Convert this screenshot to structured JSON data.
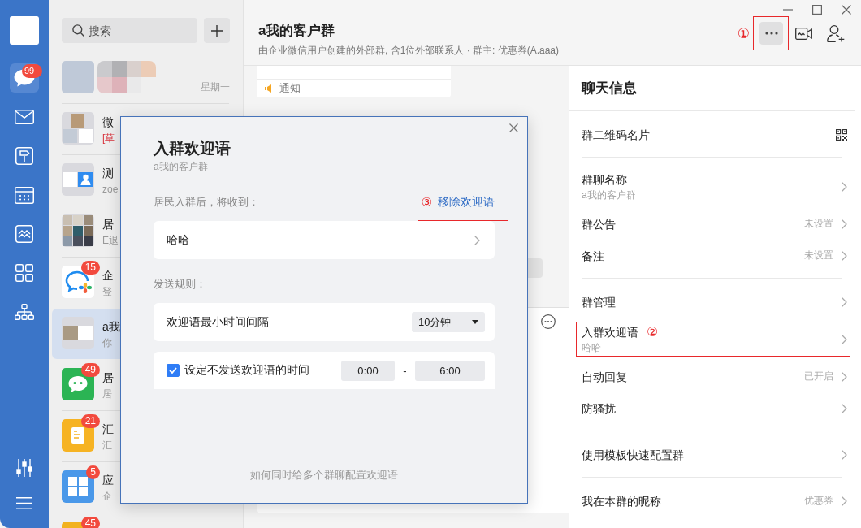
{
  "nav_rail": {
    "items": [
      {
        "kind": "chat",
        "selected": true,
        "badge": "99+"
      },
      {
        "kind": "mail",
        "selected": false
      },
      {
        "kind": "workbench",
        "selected": false
      },
      {
        "kind": "calendar",
        "selected": false
      },
      {
        "kind": "drive",
        "selected": false
      },
      {
        "kind": "apps",
        "selected": false
      },
      {
        "kind": "contacts",
        "selected": false
      }
    ]
  },
  "chat_list": {
    "search": {
      "placeholder": "搜索"
    },
    "items": [
      {
        "kind": "photo",
        "name_blurred": true,
        "time": "星期一",
        "selected": false
      },
      {
        "kind": "collage",
        "name": "微",
        "draft_tag": "[草",
        "name_blurred": false,
        "selected": false
      },
      {
        "kind": "screenshot-contact",
        "name": "测",
        "preview": "zoe",
        "name_blurred": false,
        "selected": false
      },
      {
        "kind": "photo-grid",
        "name": "居",
        "preview": "E退",
        "name_blurred": false,
        "selected": false
      },
      {
        "kind": "wecom",
        "name": "企",
        "preview": "登",
        "badge": "15",
        "name_blurred": false,
        "selected": false
      },
      {
        "kind": "screenshot-photo",
        "name": "a我",
        "preview": "你",
        "name_blurred": false,
        "selected": true
      },
      {
        "kind": "wechat",
        "name": "居",
        "preview": "居",
        "badge": "49",
        "name_blurred": false,
        "selected": false
      },
      {
        "kind": "report",
        "name": "汇",
        "preview": "汇",
        "badge": "21",
        "name_blurred": false,
        "selected": false
      },
      {
        "kind": "apps",
        "name": "应",
        "preview": "企",
        "badge": "5",
        "name_blurred": false,
        "selected": false
      },
      {
        "kind": "health",
        "badge": "45",
        "name_blurred": false,
        "selected": false
      }
    ]
  },
  "chat_header": {
    "title": "a我的客户群",
    "subtitle": "由企业微信用户创建的外部群, 含1位外部联系人 · 群主: 优惠券(A.aaa)",
    "actions": [
      {
        "kind": "more",
        "annotation": "①"
      },
      {
        "kind": "video"
      },
      {
        "kind": "add-member"
      }
    ]
  },
  "chat_area": {
    "notice": "通知"
  },
  "chat_info": {
    "title": "聊天信息",
    "groups": [
      {
        "items": [
          {
            "kind": "qr",
            "label": "群二维码名片"
          }
        ]
      },
      {
        "items": [
          {
            "kind": "link",
            "label": "群聊名称",
            "sub": "a我的客户群"
          },
          {
            "kind": "link",
            "label": "群公告",
            "value": "未设置"
          },
          {
            "kind": "link",
            "label": "备注",
            "value": "未设置"
          }
        ]
      },
      {
        "items": [
          {
            "kind": "link",
            "label": "群管理"
          },
          {
            "kind": "link",
            "label": "入群欢迎语",
            "sub": "哈哈",
            "annotation": "②"
          },
          {
            "kind": "link",
            "label": "自动回复",
            "value": "已开启"
          },
          {
            "kind": "link",
            "label": "防骚扰"
          }
        ]
      },
      {
        "items": [
          {
            "kind": "link",
            "label": "使用模板快速配置群"
          }
        ]
      },
      {
        "items": [
          {
            "kind": "link",
            "label": "我在本群的昵称",
            "value": "优惠券"
          }
        ]
      }
    ]
  },
  "dialog": {
    "title": "入群欢迎语",
    "subtitle": "a我的客户群",
    "receive_label": "居民入群后，将收到：",
    "remove_link": {
      "label": "移除欢迎语",
      "annotation": "③"
    },
    "message": "哈哈",
    "rules_label": "发送规则：",
    "interval": {
      "label": "欢迎语最小时间间隔",
      "value": "10分钟"
    },
    "quiet_time": {
      "checked": true,
      "label": "设定不发送欢迎语的时间",
      "start": "0:00",
      "separator": "-",
      "end": "6:00"
    },
    "help_link": "如何同时给多个群聊配置欢迎语"
  }
}
